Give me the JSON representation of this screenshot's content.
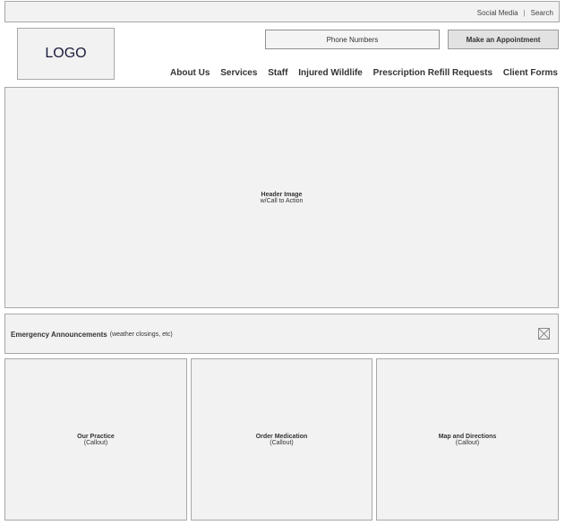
{
  "topbar": {
    "social": "Social Media",
    "separator": "|",
    "search": "Search"
  },
  "logo": {
    "text": "LOGO"
  },
  "header": {
    "phone": "Phone Numbers",
    "appointment": "Make an Appointment"
  },
  "nav": {
    "items": [
      "About Us",
      "Services",
      "Staff",
      "Injured Wildlife",
      "Prescription Refill Requests",
      "Client Forms"
    ]
  },
  "hero": {
    "title": "Header Image",
    "subtitle": "w/Call to Action"
  },
  "emergency": {
    "title": "Emergency Announcements",
    "note": "(weather closings, etc)",
    "close_icon": "close-box-icon"
  },
  "callouts": [
    {
      "title": "Our Practice",
      "subtitle": "(Callout)"
    },
    {
      "title": "Order Medication",
      "subtitle": "(Callout)"
    },
    {
      "title": "Map and Directions",
      "subtitle": "(Callout)"
    }
  ],
  "colors": {
    "panel": "#f2f2f2",
    "border": "#a8a8a8",
    "button": "#e2e2e2"
  }
}
